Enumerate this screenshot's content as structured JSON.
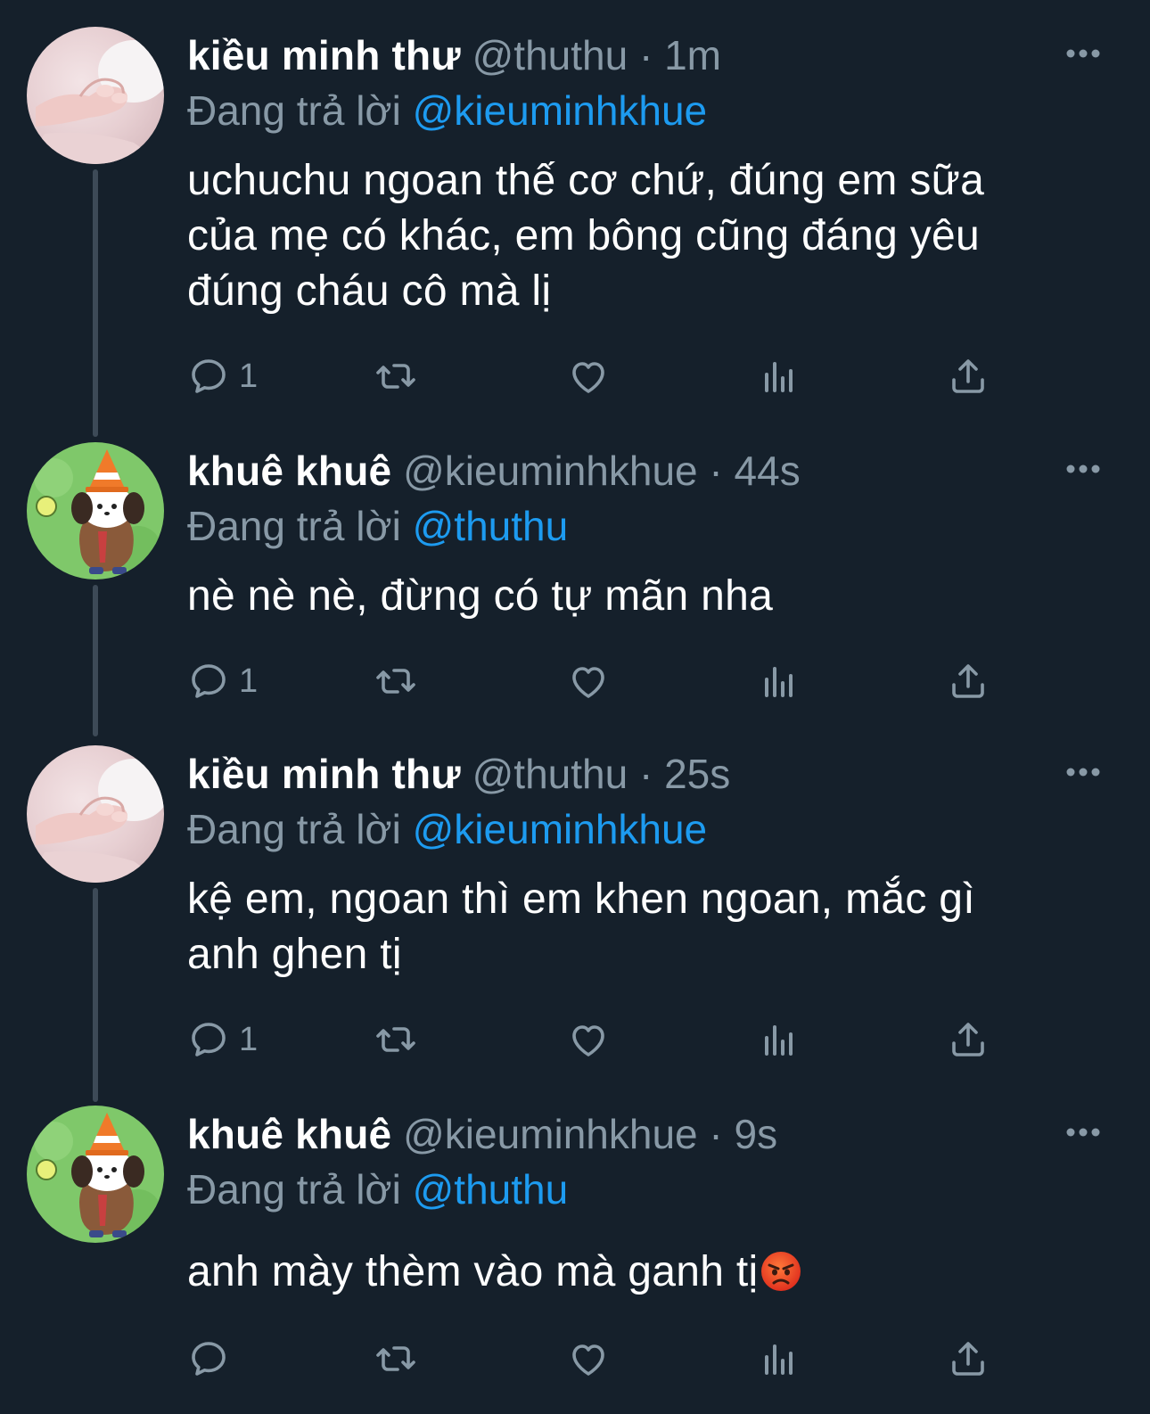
{
  "colors": {
    "background": "#15202b",
    "secondary_text": "#8899a6",
    "mention": "#1d9bf0",
    "thread_line": "#3d4a57"
  },
  "tweets": [
    {
      "name": "kiều minh thư",
      "handle": "@thuthu",
      "time": "1m",
      "replying_prefix": "Đang trả lời",
      "replying_to": "@kieuminhkhue",
      "text_lines": [
        "uchuchu ngoan thế cơ chứ, đúng em sữa",
        "của mẹ có khác, em bông cũng đáng yêu",
        "đúng cháu cô mà lị"
      ],
      "reply_count": "1",
      "avatar_icon": "baby-hand-avatar"
    },
    {
      "name": "khuê khuê",
      "handle": "@kieuminhkhue",
      "time": "44s",
      "replying_prefix": "Đang trả lời",
      "replying_to": "@thuthu",
      "text_lines": [
        "nè nè nè, đừng có tự mãn nha"
      ],
      "reply_count": "1",
      "avatar_icon": "cartoon-dog-cone-avatar"
    },
    {
      "name": "kiều minh thư",
      "handle": "@thuthu",
      "time": "25s",
      "replying_prefix": "Đang trả lời",
      "replying_to": "@kieuminhkhue",
      "text_lines": [
        "kệ em, ngoan thì em khen ngoan, mắc gì",
        "anh ghen tị"
      ],
      "reply_count": "1",
      "avatar_icon": "baby-hand-avatar"
    },
    {
      "name": "khuê khuê",
      "handle": "@kieuminhkhue",
      "time": "9s",
      "replying_prefix": "Đang trả lời",
      "replying_to": "@thuthu",
      "text_lines": [
        "anh mày thèm vào mà ganh tị"
      ],
      "text_emoji": "angry-face-emoji",
      "reply_count": "",
      "avatar_icon": "cartoon-dog-cone-avatar"
    }
  ],
  "separator": "·"
}
